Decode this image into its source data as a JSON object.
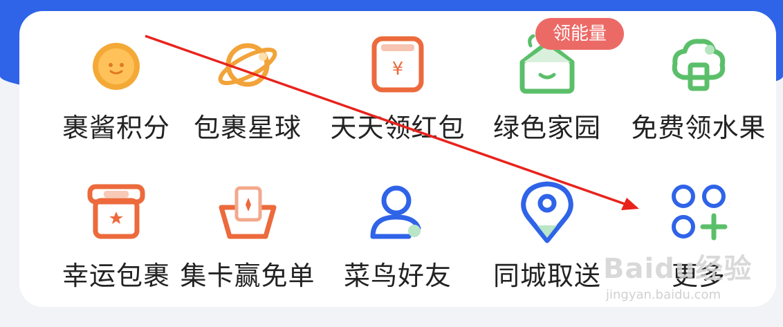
{
  "badge": {
    "label": "领能量"
  },
  "grid": {
    "row1": [
      {
        "label": "裹酱积分",
        "icon": "coin-face-icon"
      },
      {
        "label": "包裹星球",
        "icon": "planet-icon"
      },
      {
        "label": "天天领红包",
        "icon": "red-envelope-icon"
      },
      {
        "label": "绿色家园",
        "icon": "green-house-icon"
      },
      {
        "label": "免费领水果",
        "icon": "fruit-tree-icon"
      }
    ],
    "row2": [
      {
        "label": "幸运包裹",
        "icon": "lucky-box-icon"
      },
      {
        "label": "集卡赢免单",
        "icon": "card-box-icon"
      },
      {
        "label": "菜鸟好友",
        "icon": "friend-icon"
      },
      {
        "label": "同城取送",
        "icon": "location-pin-icon"
      },
      {
        "label": "更多",
        "icon": "more-grid-icon"
      }
    ]
  },
  "watermark": {
    "main": "Baidu经验",
    "sub": "jingyan.baidu.com"
  },
  "colors": {
    "header_blue": "#2f63e8",
    "badge_red": "#ec6a66",
    "arrow_red": "#e8231c",
    "icon_orange": "#f2a33a",
    "icon_red_orange": "#ec6a3c",
    "icon_green": "#5bbf6a",
    "icon_blue": "#2f63e8"
  }
}
